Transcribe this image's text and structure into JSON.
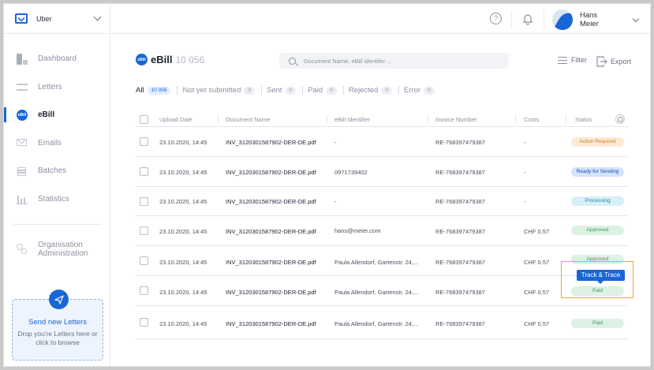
{
  "org": {
    "name": "Uber"
  },
  "nav": {
    "items": [
      {
        "label": "Dashboard",
        "icon": "dashboard-icon",
        "active": false
      },
      {
        "label": "Letters",
        "icon": "letters-icon",
        "active": false
      },
      {
        "label": "eBill",
        "icon": "ebill-icon",
        "active": true
      },
      {
        "label": "Emails",
        "icon": "mail-icon",
        "active": false
      },
      {
        "label": "Batches",
        "icon": "layers-icon",
        "active": false
      },
      {
        "label": "Statistics",
        "icon": "bar-chart-icon",
        "active": false
      }
    ],
    "admin": {
      "line1": "Organisation",
      "line2": "Administration",
      "icon": "gears-icon"
    },
    "ebill_icon_text": "eBill"
  },
  "upload": {
    "title": "Send new Letters",
    "subtitle": "Drop you're Letters here or click to browse"
  },
  "user": {
    "first": "Hans",
    "last": "Meier"
  },
  "page": {
    "title": "eBill",
    "count": "10 056",
    "title_icon_text": "eBill"
  },
  "search": {
    "placeholder": "Document Name, eBill identifer ..."
  },
  "toolbar": {
    "filter": "Filter",
    "export": "Export"
  },
  "tabs": [
    {
      "label": "All",
      "count": "10 056",
      "active": true
    },
    {
      "label": "Not yet submitted",
      "count": "0",
      "active": false
    },
    {
      "label": "Sent",
      "count": "0",
      "active": false
    },
    {
      "label": "Paid",
      "count": "0",
      "active": false
    },
    {
      "label": "Rejected",
      "count": "0",
      "active": false
    },
    {
      "label": "Error",
      "count": "0",
      "active": false
    }
  ],
  "table": {
    "columns": {
      "upload_date": "Upload Date",
      "document_name": "Document Name",
      "ebill_identifier": "eBill Identifier",
      "invoice_number": "Invoice Number",
      "costs": "Costs",
      "status": "Status"
    },
    "rows": [
      {
        "date": "23.10.2020, 14:45",
        "doc": "INV_3120301587902-DER-DE.pdf",
        "ident": "-",
        "invoice": "RE-768397479387",
        "costs": "-",
        "status": "Action Required",
        "status_kind": "action"
      },
      {
        "date": "23.10.2020, 14:45",
        "doc": "INV_3120301587902-DER-DE.pdf",
        "ident": "0971739402",
        "invoice": "RE-768397479387",
        "costs": "-",
        "status": "Ready for Sending",
        "status_kind": "ready"
      },
      {
        "date": "23.10.2020, 14:45",
        "doc": "INV_3120301587902-DER-DE.pdf",
        "ident": "-",
        "invoice": "RE-768397479387",
        "costs": "-",
        "status": "Processing",
        "status_kind": "processing"
      },
      {
        "date": "23.10.2020, 14:45",
        "doc": "INV_3120301587902-DER-DE.pdf",
        "ident": "hans@meier.com",
        "invoice": "RE-768397479387",
        "costs": "CHF 0.57",
        "status": "Approved",
        "status_kind": "approved"
      },
      {
        "date": "23.10.2020, 14:45",
        "doc": "INV_3120301587902-DER-DE.pdf",
        "ident": "Paula Allendorf, Gartenstr. 24,...",
        "invoice": "RE-768397479387",
        "costs": "CHF 0.57",
        "status": "Approved",
        "status_kind": "approved"
      },
      {
        "date": "23.10.2020, 14:45",
        "doc": "INV_3120301587902-DER-DE.pdf",
        "ident": "Paula Allendorf, Gartenstr. 24,...",
        "invoice": "RE-768397479387",
        "costs": "CHF 0.57",
        "status": "Paid",
        "status_kind": "paid"
      },
      {
        "date": "23.10.2020, 14:45",
        "doc": "INV_3120301587902-DER-DE.pdf",
        "ident": "Paula Allendorf, Gartenstr. 24,...",
        "invoice": "RE-768397479387",
        "costs": "CHF 0.57",
        "status": "Paid",
        "status_kind": "paid"
      }
    ]
  },
  "tooltip": {
    "label": "Track & Trace"
  },
  "colors": {
    "accent": "#1866d6",
    "highlight": "#f0a53a"
  }
}
